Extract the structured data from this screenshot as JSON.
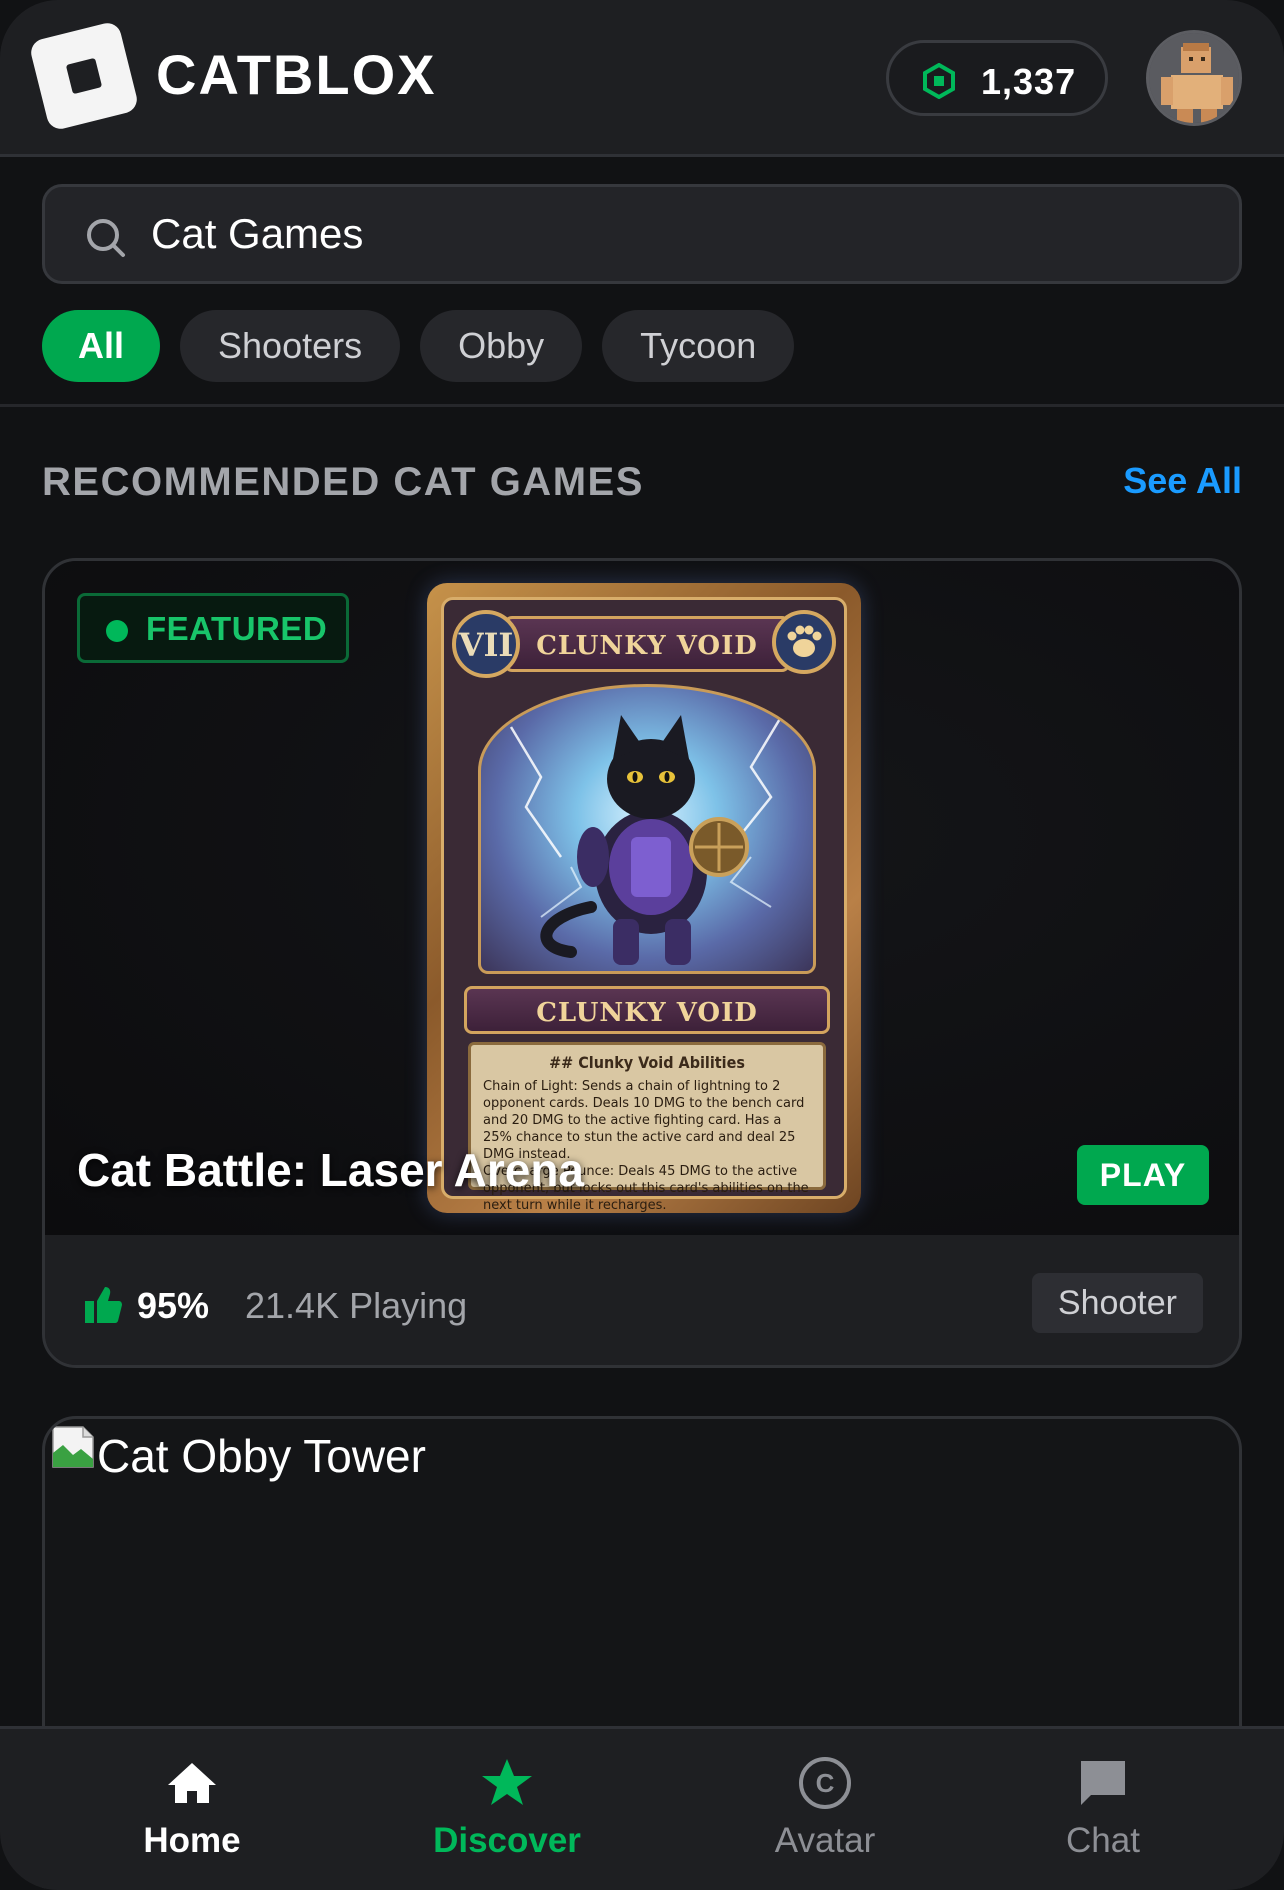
{
  "header": {
    "brand": "CATBLOX",
    "currency_value": "1,337",
    "logo_icon": "catblox-logo-icon",
    "currency_icon": "robux-hexagon-icon",
    "avatar_icon": "user-avatar-icon"
  },
  "search": {
    "value": "Cat Games",
    "icon": "search-icon"
  },
  "filters": {
    "items": [
      "All",
      "Shooters",
      "Obby",
      "Tycoon"
    ],
    "active": "All"
  },
  "section": {
    "title": "RECOMMENDED CAT GAMES",
    "see_all": "See All"
  },
  "featured_game": {
    "badge": "FEATURED",
    "title": "Cat Battle: Laser Arena",
    "play_label": "PLAY",
    "rating": "95%",
    "players": "21.4K Playing",
    "genre": "Shooter",
    "card_art": {
      "level": "VII",
      "name": "CLUNKY VOID",
      "abilities_header": "## Clunky Void Abilities",
      "ability_1": "Chain of Light: Sends a chain of lightning to 2 opponent cards. Deals 10 DMG to the bench card and 20 DMG to the active fighting card. Has a 25% chance to stun the active card and deal 25 DMG instead.",
      "ability_2": "Overcharge Pounce: Deals 45 DMG to the active opponent, but locks out this card's abilities on the next turn while it recharges."
    }
  },
  "second_game": {
    "title": "Cat Obby Tower"
  },
  "bottom_nav": {
    "items": [
      {
        "label": "Home",
        "icon": "home-icon"
      },
      {
        "label": "Discover",
        "icon": "star-icon"
      },
      {
        "label": "Avatar",
        "icon": "avatar-c-icon"
      },
      {
        "label": "Chat",
        "icon": "chat-bubble-icon"
      }
    ]
  },
  "colors": {
    "accent_green": "#00a84f",
    "link_blue": "#1a9bff",
    "background": "#111214",
    "surface": "#1e1f22"
  }
}
